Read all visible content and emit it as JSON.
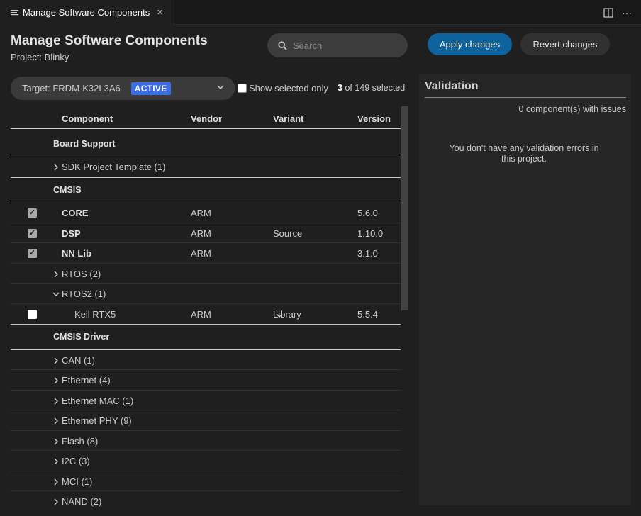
{
  "tab": {
    "title": "Manage Software Components",
    "close": "×"
  },
  "tab_actions": {
    "split_icon": "split-editor-icon",
    "more": "···"
  },
  "header": {
    "title": "Manage Software Components",
    "project": "Project: Blinky"
  },
  "search": {
    "placeholder": "Search"
  },
  "buttons": {
    "apply": "Apply changes",
    "revert": "Revert changes"
  },
  "target": {
    "label": "Target: FRDM-K32L3A6",
    "badge": "ACTIVE",
    "badge_color": "#3a6ee8"
  },
  "show_selected": {
    "label": "Show selected only",
    "checked": false
  },
  "selection": {
    "count": "3",
    "suffix": " of 149 selected"
  },
  "columns": {
    "component": "Component",
    "vendor": "Vendor",
    "variant": "Variant",
    "version": "Version"
  },
  "rows": [
    {
      "type": "category",
      "name": "Board Support"
    },
    {
      "type": "group",
      "name": "SDK Project Template (1)",
      "expanded": false
    },
    {
      "type": "category",
      "name": "CMSIS"
    },
    {
      "type": "item",
      "name": "CORE",
      "vendor": "ARM",
      "variant": "",
      "version": "5.6.0",
      "checked": true
    },
    {
      "type": "item",
      "name": "DSP",
      "vendor": "ARM",
      "variant": "Source",
      "version": "1.10.0",
      "checked": true
    },
    {
      "type": "item",
      "name": "NN Lib",
      "vendor": "ARM",
      "variant": "",
      "version": "3.1.0",
      "checked": true
    },
    {
      "type": "group",
      "name": "RTOS (2)",
      "expanded": false
    },
    {
      "type": "group",
      "name": "RTOS2 (1)",
      "expanded": true
    },
    {
      "type": "item",
      "name": "Keil RTX5",
      "vendor": "ARM",
      "variant": "Library",
      "version": "5.5.4",
      "checked": false
    },
    {
      "type": "category",
      "name": "CMSIS Driver"
    },
    {
      "type": "group",
      "name": "CAN (1)",
      "expanded": false
    },
    {
      "type": "group",
      "name": "Ethernet (4)",
      "expanded": false
    },
    {
      "type": "group",
      "name": "Ethernet MAC (1)",
      "expanded": false
    },
    {
      "type": "group",
      "name": "Ethernet PHY (9)",
      "expanded": false
    },
    {
      "type": "group",
      "name": "Flash (8)",
      "expanded": false
    },
    {
      "type": "group",
      "name": "I2C (3)",
      "expanded": false
    },
    {
      "type": "group",
      "name": "MCI (1)",
      "expanded": false
    },
    {
      "type": "group",
      "name": "NAND (2)",
      "expanded": false
    }
  ],
  "validation": {
    "title": "Validation",
    "count": "0 component(s) with issues",
    "message": "You don't have any validation errors in this project."
  },
  "colors": {
    "accent": "#0e639c",
    "background": "#1f1f1f",
    "panel": "#262626"
  }
}
